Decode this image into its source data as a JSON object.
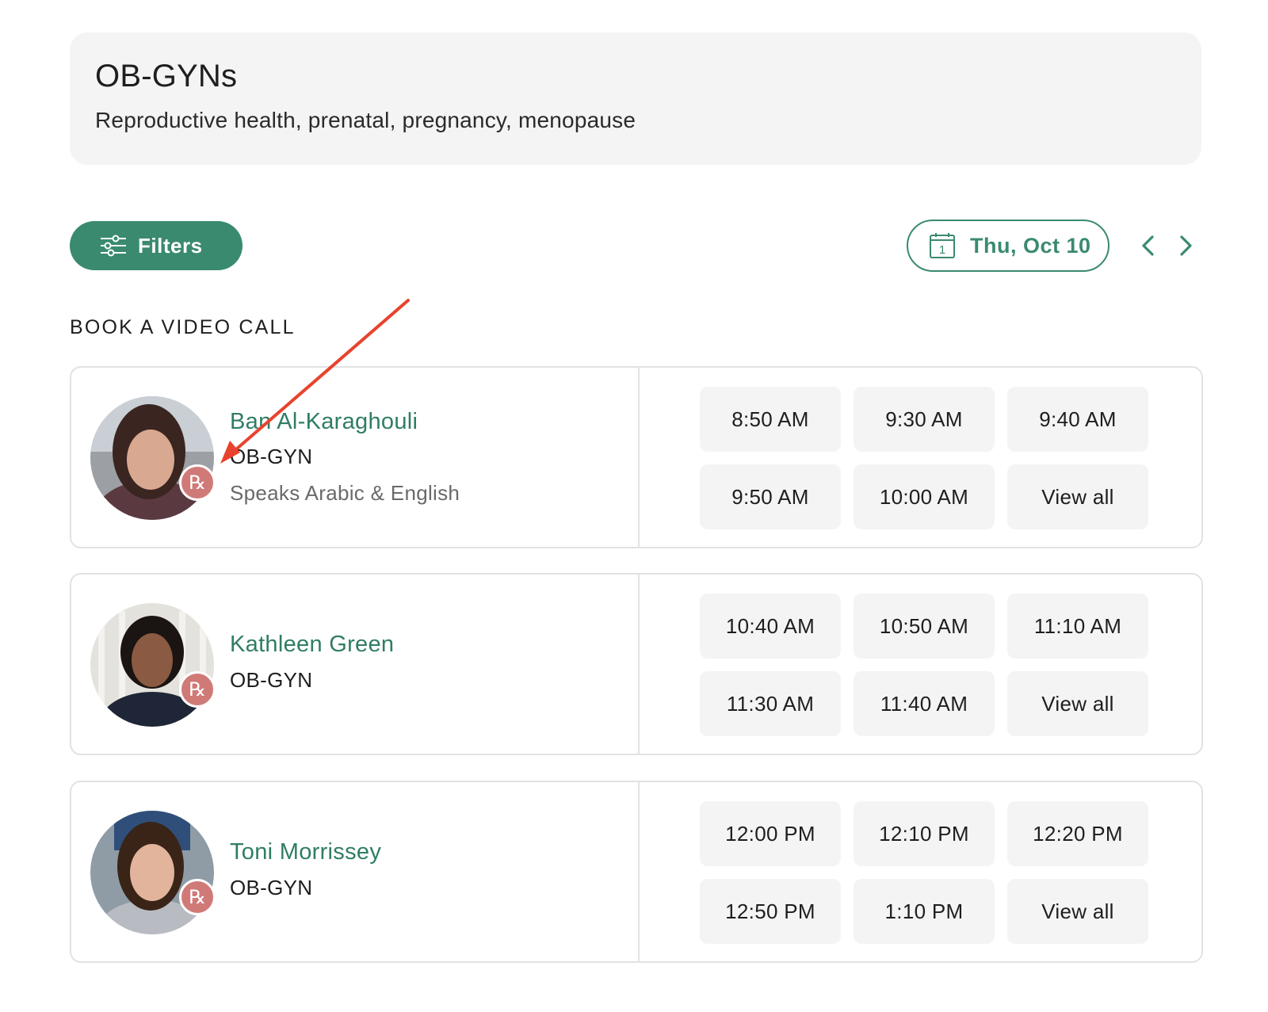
{
  "header": {
    "title": "OB-GYNs",
    "subtitle": "Reproductive health, prenatal, pregnancy, menopause"
  },
  "toolbar": {
    "filters_label": "Filters",
    "filters_icon": "sliders-icon",
    "date_label": "Thu, Oct 10",
    "calendar_day": "1",
    "prev_icon": "chevron-left-icon",
    "next_icon": "chevron-right-icon"
  },
  "section": {
    "heading": "BOOK A VIDEO CALL"
  },
  "badge": {
    "rx_text": "℞"
  },
  "doctors": [
    {
      "name": "Ban Al-Karaghouli",
      "specialty": "OB-GYN",
      "languages": "Speaks Arabic & English",
      "slots": [
        "8:50 AM",
        "9:30 AM",
        "9:40 AM",
        "9:50 AM",
        "10:00 AM",
        "View all"
      ]
    },
    {
      "name": "Kathleen Green",
      "specialty": "OB-GYN",
      "slots": [
        "10:40 AM",
        "10:50 AM",
        "11:10 AM",
        "11:30 AM",
        "11:40 AM",
        "View all"
      ]
    },
    {
      "name": "Toni Morrissey",
      "specialty": "OB-GYN",
      "slots": [
        "12:00 PM",
        "12:10 PM",
        "12:20 PM",
        "12:50 PM",
        "1:10 PM",
        "View all"
      ]
    }
  ],
  "colors": {
    "brand_green": "#3a8a70",
    "name_green": "#2f7d64",
    "rx_badge": "#d07a78",
    "annotation_arrow": "#e8432d",
    "card_bg": "#f4f4f4"
  }
}
